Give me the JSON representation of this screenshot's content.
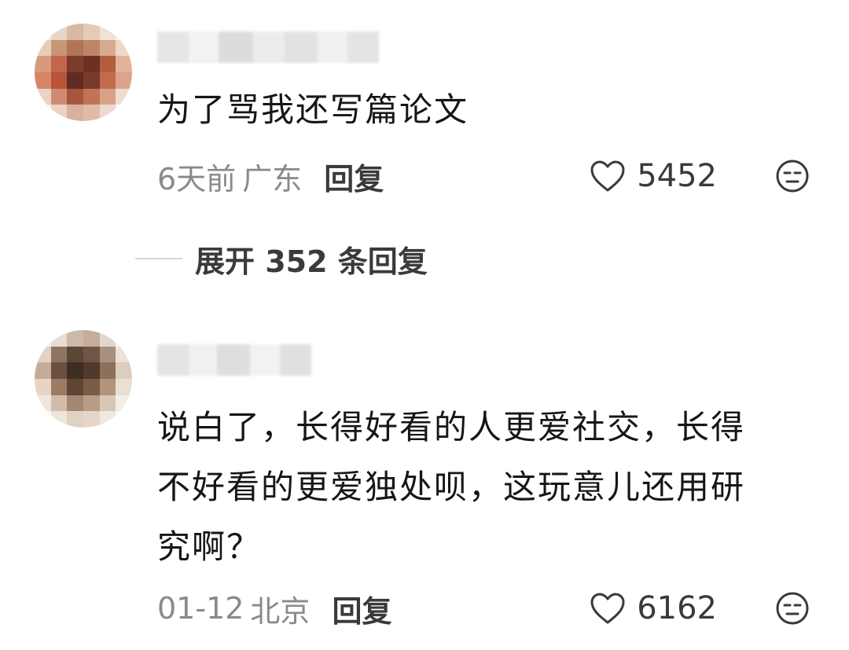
{
  "comments": [
    {
      "text": "为了骂我还写篇论文",
      "time": "6天前",
      "location": "广东",
      "reply_label": "回复",
      "likes": "5452",
      "avatar_icon": "pixelated-avatar",
      "emoji_icon": "neutral-face-icon"
    },
    {
      "text_lines": [
        "说白了，长得好看的人更爱社交，长得",
        "不好看的更爱独处呗，这玩意儿还用研",
        "究啊？"
      ],
      "time": "01-12",
      "location": "北京",
      "reply_label": "回复",
      "likes": "6162",
      "avatar_icon": "pixelated-avatar",
      "emoji_icon": "neutral-face-icon"
    }
  ],
  "expand_replies": {
    "label": "展开 352 条回复"
  },
  "colors": {
    "text": "#161616",
    "meta": "#8a8a8a",
    "action": "#3a3a3a"
  }
}
